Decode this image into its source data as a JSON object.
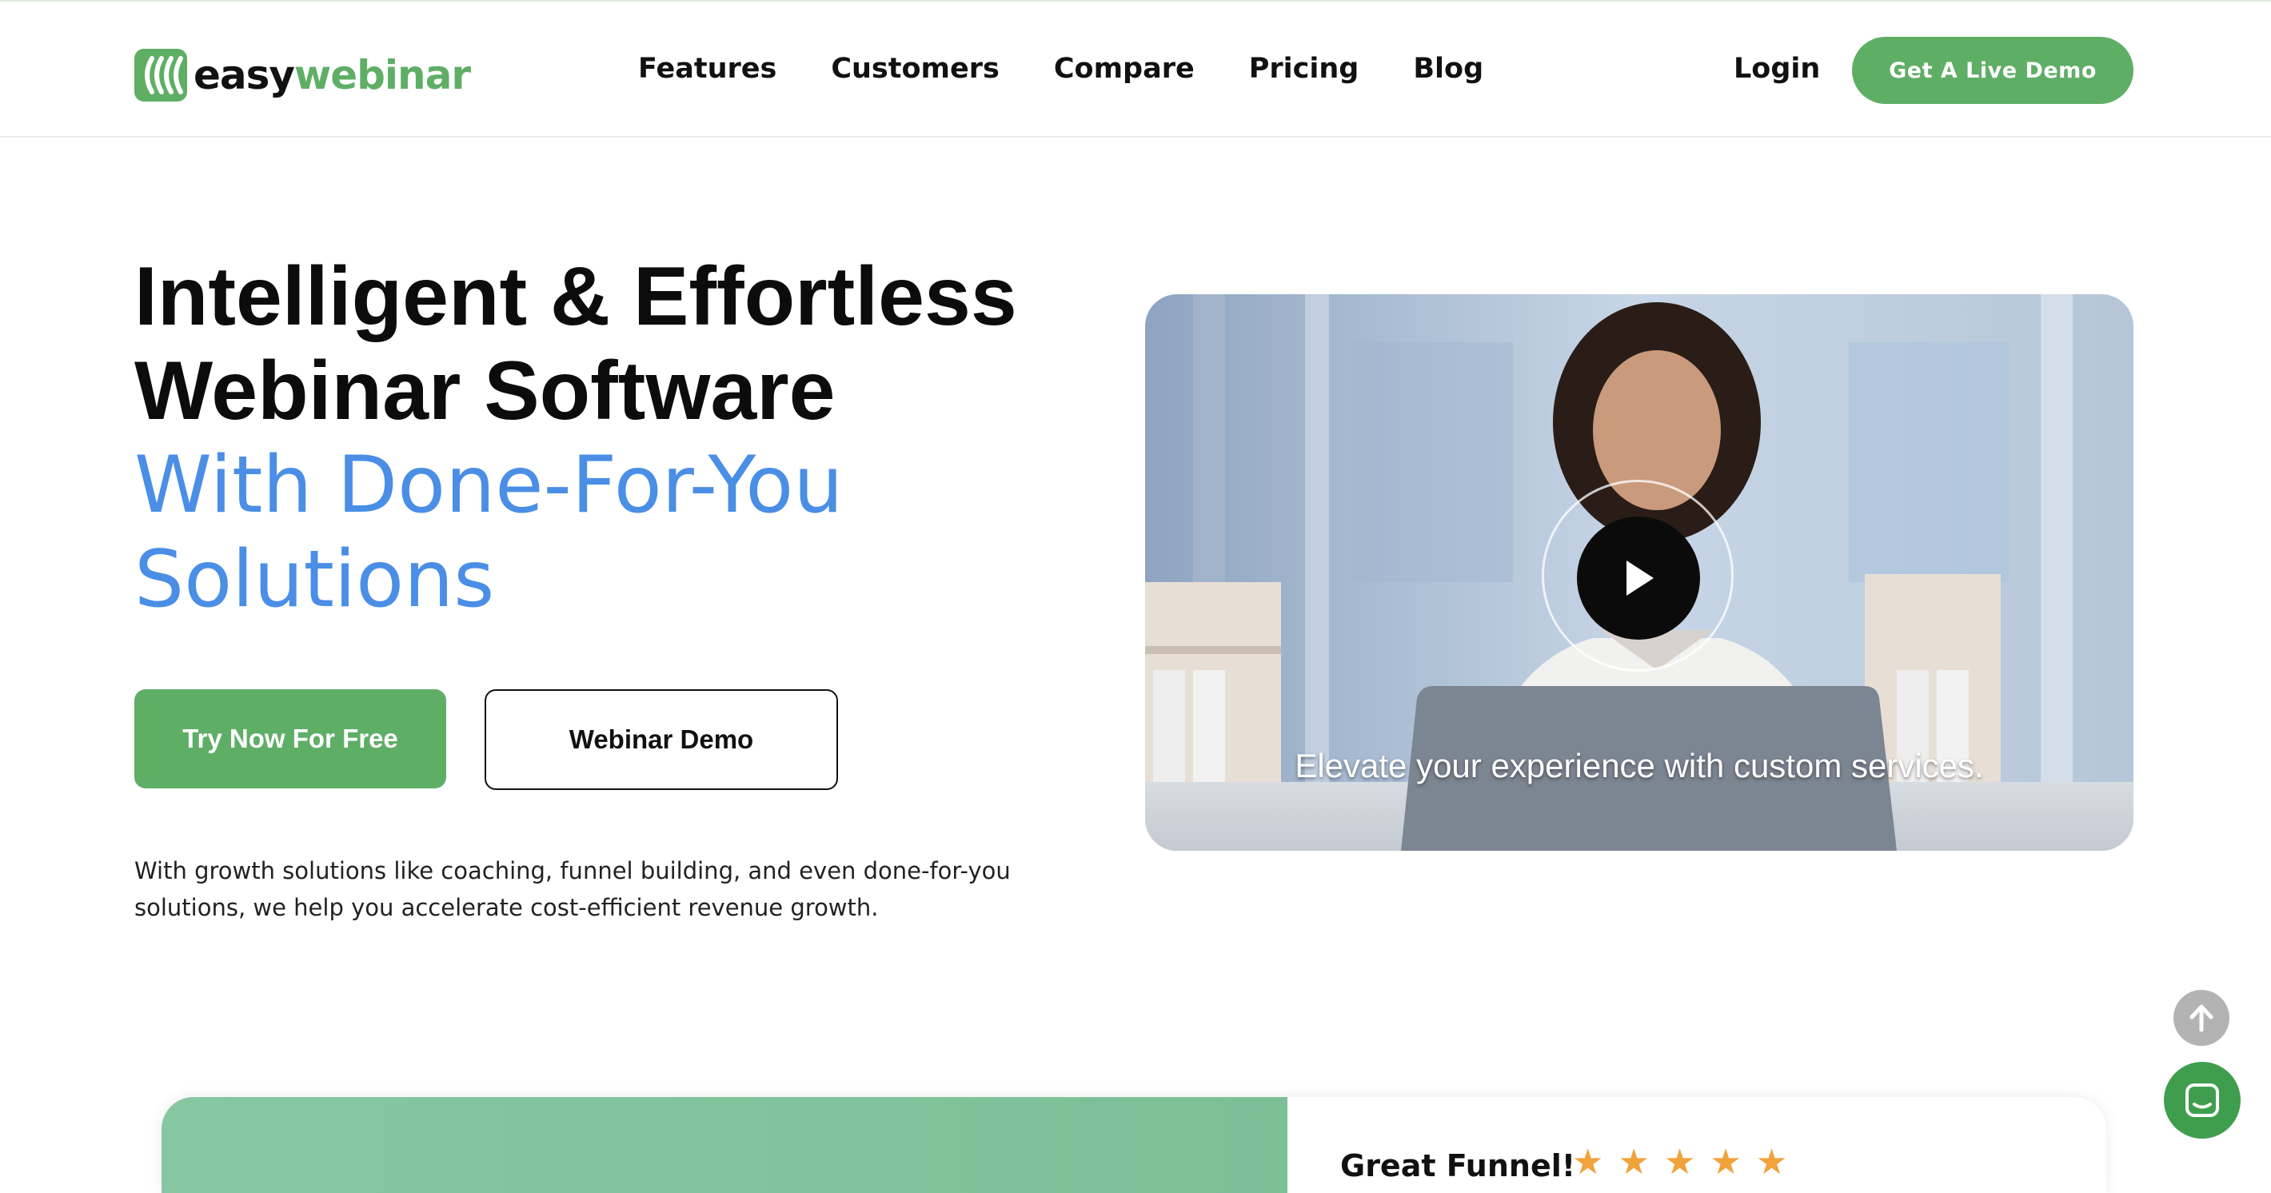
{
  "brand": {
    "name_part1": "easy",
    "name_part2": "webinar",
    "color": "#5fae66"
  },
  "nav": {
    "items": [
      "Features",
      "Customers",
      "Compare",
      "Pricing",
      "Blog"
    ],
    "login_label": "Login",
    "cta_label": "Get A Live Demo"
  },
  "hero": {
    "title_line1": "Intelligent & Effortless",
    "title_line2": "Webinar Software",
    "title_line3": "With Done-For-You",
    "title_line4": "Solutions",
    "primary_button": "Try Now For Free",
    "secondary_button": "Webinar Demo",
    "description_line1": "With growth solutions like coaching, funnel building, and even done-for-you",
    "description_line2": "solutions, we help you accelerate cost-efficient revenue growth.",
    "accent_color": "#4a8ee6"
  },
  "video": {
    "caption": "Elevate your experience with custom services.",
    "play_icon": "play-icon"
  },
  "widgets": {
    "scroll_top_icon": "arrow-up-icon",
    "chat_icon": "chat-icon"
  },
  "review": {
    "title": "Great Funnel!",
    "stars": 5,
    "star_color": "#f0a23b"
  }
}
